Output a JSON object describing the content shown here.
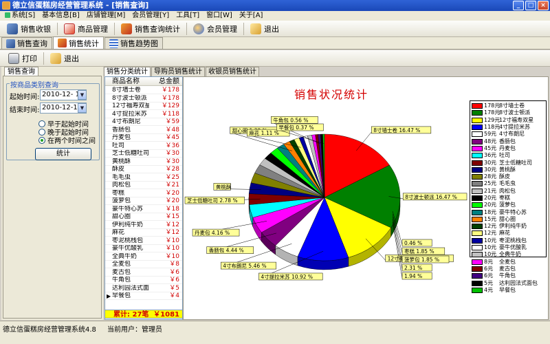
{
  "window": {
    "title": "德立信蛋糕房经营管理系统 - [销售查询]",
    "controls": [
      "_",
      "□",
      "×"
    ]
  },
  "menubar": [
    "系统[S]",
    "基本信息[B]",
    "店铺管理[M]",
    "会员管理[Y]",
    "工具[T]",
    "窗口[W]",
    "关于[A]"
  ],
  "main_toolbar": [
    "销售收银",
    "商品管理",
    "销售查询统计",
    "会员管理",
    "退出"
  ],
  "window_tabs": [
    "销售查询",
    "销售统计",
    "销售趋势图"
  ],
  "sub_toolbar": [
    "打印",
    "退出"
  ],
  "left_panel": {
    "tab": "销售查询",
    "group_title": "按商品类别查询",
    "start_label": "起始时间:",
    "start_value": "2010-12- 1",
    "end_label": "结束时间:",
    "end_value": "2010-12-14",
    "options": [
      "早于起始时间",
      "晚于起始时间",
      "在两个时间之间"
    ],
    "selected_option": 2,
    "stat_button": "统计"
  },
  "center_tabs": [
    "销售分类统计",
    "导购员销售统计",
    "收银员销售统计"
  ],
  "grid": {
    "headers": [
      "商品名称",
      "总金额"
    ],
    "rows": [
      [
        "8寸墙士卷",
        "￥178"
      ],
      [
        "8寸波士顿派",
        "￥178"
      ],
      [
        "12寸福寿双星",
        "￥129"
      ],
      [
        "4寸提拉米苏",
        "￥118"
      ],
      [
        "4寸布朗尼",
        "￥59"
      ],
      [
        "香肠包",
        "￥48"
      ],
      [
        "丹麦包",
        "￥45"
      ],
      [
        "吐司",
        "￥36"
      ],
      [
        "芝士低糖吐司",
        "￥30"
      ],
      [
        "黄桃酥",
        "￥30"
      ],
      [
        "酥皮",
        "￥28"
      ],
      [
        "毛毛虫",
        "￥25"
      ],
      [
        "肉松包",
        "￥21"
      ],
      [
        "枣糕",
        "￥20"
      ],
      [
        "菠萝包",
        "￥20"
      ],
      [
        "豪牛特心苏",
        "￥18"
      ],
      [
        "甜心圈",
        "￥15"
      ],
      [
        "伊利纯牛奶",
        "￥12"
      ],
      [
        "麻花",
        "￥12"
      ],
      [
        "枣泥桃栈包",
        "￥10"
      ],
      [
        "豪牛优酸乳",
        "￥10"
      ],
      [
        "全典牛奶",
        "￥10"
      ],
      [
        "全麦包",
        "￥8"
      ],
      [
        "麦古包",
        "￥6"
      ],
      [
        "牛角包",
        "￥6"
      ],
      [
        "达利园法式面包",
        "￥5"
      ],
      [
        "早餐包",
        "￥4"
      ]
    ],
    "selected_row": 26,
    "footer_label": "累计: 27笔",
    "footer_total": "￥1081"
  },
  "chart_data": {
    "type": "pie",
    "title": "销售状况统计",
    "legend_position": "right",
    "slices": [
      {
        "label": "8寸墙士卷",
        "value": 178,
        "legend_value": "178元",
        "pct_label": "8寸墙士卷 16.47 %",
        "color": "#ff0000"
      },
      {
        "label": "8寸波士顿派",
        "value": 178,
        "legend_value": "178元",
        "pct_label": "8寸波士顿派 16.47 %",
        "color": "#008000"
      },
      {
        "label": "12寸福寿双星",
        "value": 129,
        "legend_value": "129元",
        "pct_label": "12寸福寿双星 11.93 %",
        "color": "#ffff00"
      },
      {
        "label": "4寸提拉米苏",
        "value": 118,
        "legend_value": "118元",
        "pct_label": "4寸提拉米苏 10.92 %",
        "color": "#0000ff"
      },
      {
        "label": "4寸布朗尼",
        "value": 59,
        "legend_value": "59元",
        "pct_label": "4寸布朗尼 5.46 %",
        "color": "#ffffff"
      },
      {
        "label": "香肠包",
        "value": 48,
        "legend_value": "48元",
        "pct_label": "香肠包 4.44 %",
        "color": "#800080"
      },
      {
        "label": "丹麦包",
        "value": 45,
        "legend_value": "45元",
        "pct_label": "丹麦包 4.16 %",
        "color": "#ff00ff"
      },
      {
        "label": "吐司",
        "value": 36,
        "legend_value": "36元",
        "pct_label": "",
        "color": "#00ffff"
      },
      {
        "label": "芝士低糖吐司",
        "value": 30,
        "legend_value": "30元",
        "pct_label": "芝士低糖吐司 2.78 %",
        "color": "#800000"
      },
      {
        "label": "黄桃酥",
        "value": 30,
        "legend_value": "30元",
        "pct_label": "黄桃酥",
        "color": "#000080"
      },
      {
        "label": "酥皮",
        "value": 28,
        "legend_value": "28元",
        "pct_label": "",
        "color": "#808000"
      },
      {
        "label": "毛毛虫",
        "value": 25,
        "legend_value": "25元",
        "pct_label": "",
        "color": "#808080"
      },
      {
        "label": "肉松包",
        "value": 21,
        "legend_value": "21元",
        "pct_label": "",
        "color": "#c0c0c0"
      },
      {
        "label": "枣糕",
        "value": 20,
        "legend_value": "20元",
        "pct_label": "",
        "color": "#000000"
      },
      {
        "label": "菠萝包",
        "value": 20,
        "legend_value": "20元",
        "pct_label": "",
        "color": "#00ff00"
      },
      {
        "label": "豪牛特心苏",
        "value": 18,
        "legend_value": "18元",
        "pct_label": "",
        "color": "#008080"
      },
      {
        "label": "甜心圈",
        "value": 15,
        "legend_value": "15元",
        "pct_label": "甜心圈 1.39 %",
        "color": "#ff8000"
      },
      {
        "label": "伊利纯牛奶",
        "value": 12,
        "legend_value": "12元",
        "pct_label": "",
        "color": "#004000"
      },
      {
        "label": "麻花",
        "value": 12,
        "legend_value": "12元",
        "pct_label": "麻花 1.11 %",
        "color": "#ffff80"
      },
      {
        "label": "枣泥桃栈包",
        "value": 10,
        "legend_value": "10元",
        "pct_label": "",
        "color": "#0000a0"
      },
      {
        "label": "豪牛优酸乳",
        "value": 10,
        "legend_value": "10元",
        "pct_label": "",
        "color": "#ffffff"
      },
      {
        "label": "全典牛奶",
        "value": 10,
        "legend_value": "10元",
        "pct_label": "",
        "color": "#c0c0c0"
      },
      {
        "label": "全麦包",
        "value": 8,
        "legend_value": "8元",
        "pct_label": "",
        "color": "#ff00ff"
      },
      {
        "label": "麦古包",
        "value": 6,
        "legend_value": "6元",
        "pct_label": "",
        "color": "#800000"
      },
      {
        "label": "牛角包",
        "value": 6,
        "legend_value": "6元",
        "pct_label": "牛角包 0.56 %",
        "color": "#400080"
      },
      {
        "label": "达利园法式面包",
        "value": 5,
        "legend_value": "5元",
        "pct_label": "",
        "color": "#000000"
      },
      {
        "label": "早餐包",
        "value": 4,
        "legend_value": "4元",
        "pct_label": "早餐包 0.37 %",
        "color": "#00c000"
      }
    ],
    "extra_labels": [
      "0.46 %",
      "枣糕 1.85 %",
      "菠萝包 1.85 %",
      "2.31 %",
      "1.94 %"
    ]
  },
  "statusbar": {
    "app": "德立信蛋糕房经营管理系统4.8",
    "user": "当前用户：管理员"
  }
}
